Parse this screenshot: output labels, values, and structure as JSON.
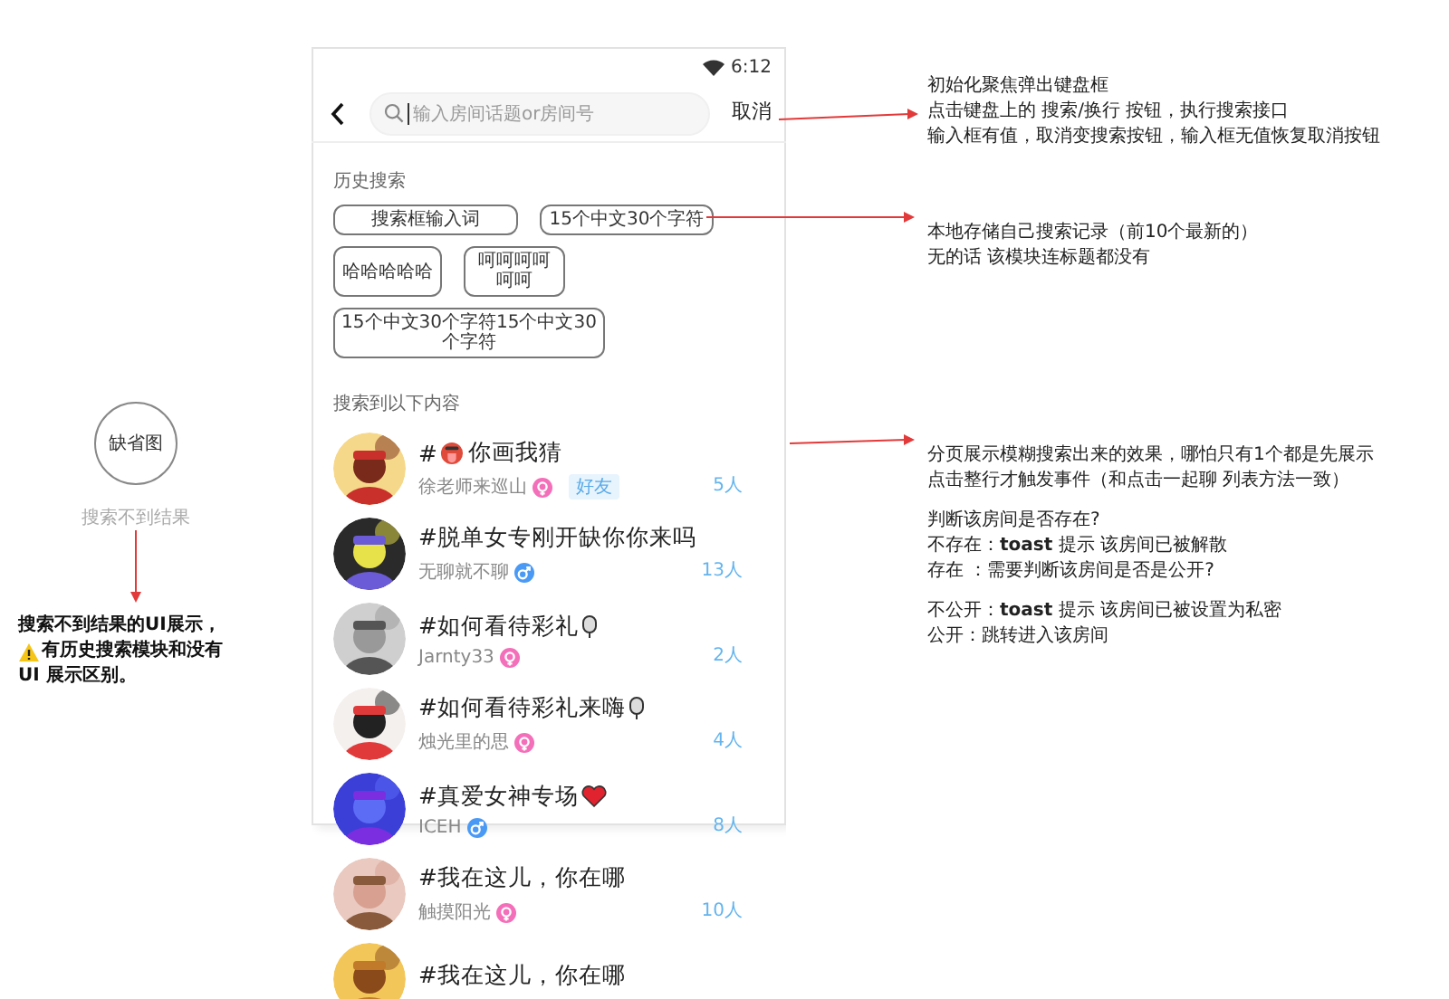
{
  "phone": {
    "status_bar": {
      "time": "6:12"
    },
    "search": {
      "placeholder": "输入房间话题or房间号",
      "focused": true
    },
    "cancel_button": "取消",
    "history": {
      "title": "历史搜索",
      "tags": [
        "搜索框输入词",
        "15个中文30个字符",
        "哈哈哈哈哈",
        "呵呵呵呵呵呵",
        "15个中文30个字符15个中文30个字符"
      ]
    },
    "results": {
      "title": "搜索到以下内容",
      "rooms": [
        {
          "title": [
            "#",
            "你画我猜"
          ],
          "host": "徐老师来巡山",
          "color": "#f46fb9",
          "tag": "好友",
          "count": "5人"
        },
        {
          "title": [
            "#脱单女专刚开缺你你来吗"
          ],
          "host": "无聊就不聊",
          "color": "#4a9af5",
          "count": "13人"
        },
        {
          "title": [
            "#如何看待彩礼"
          ],
          "host": "Jarnty33",
          "color": "#f46fb9",
          "count": "2人"
        },
        {
          "title": [
            "#如何看待彩礼来嗨"
          ],
          "host": "烛光里的思",
          "color": "#f46fb9",
          "count": "4人"
        },
        {
          "title": [
            "#真爱女神专场"
          ],
          "host": "ICEH",
          "color": "#4a9af5",
          "count": "8人"
        },
        {
          "title": [
            "#我在这儿，你在哪"
          ],
          "host": "触摸阳光",
          "color": "#f46fb9",
          "count": "10人"
        },
        {
          "title": [
            "#我在这儿，你在哪"
          ]
        }
      ]
    }
  },
  "empty_state": {
    "image_label": "缺省图",
    "caption": "搜索不到结果",
    "note": [
      {
        "text": "搜索不到结果的UI展示，",
        "warning": false
      },
      {
        "text": "有历史搜索模块和没有",
        "warning": true
      },
      {
        "text": "UI 展示区别。",
        "warning": false
      }
    ]
  },
  "annotations": [
    {
      "paragraphs": [
        [
          "初始化聚焦弹出键盘框",
          "点击键盘上的 搜索/换行 按钮，执行搜索接口",
          "输入框有值，取消变搜索按钮，输入框无值恢复取消按钮"
        ]
      ]
    },
    {
      "paragraphs": [
        [
          "本地存储自己搜索记录（前10个最新的）",
          "无的话 该模块连标题都没有"
        ]
      ]
    },
    {
      "paragraphs": [
        [
          "分页展示模糊搜索出来的效果，哪怕只有1个都是先展示",
          "点击整行才触发事件（和点击一起聊 列表方法一致）"
        ],
        [
          "判断该房间是否存在?",
          "不存在：**toast** 提示 该房间已被解散",
          "存在  ：需要判断该房间是否是公开?"
        ],
        [
          "不公开：**toast** 提示 该房间已被设置为私密",
          "公开：跳转进入该房间"
        ]
      ]
    }
  ]
}
